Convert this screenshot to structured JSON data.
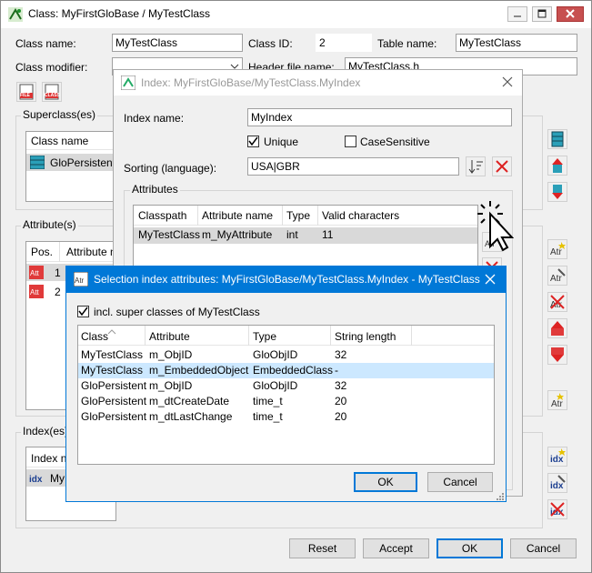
{
  "main": {
    "title": "Class: MyFirstGloBase / MyTestClass",
    "class_name_label": "Class name:",
    "class_name_value": "MyTestClass",
    "class_id_label": "Class ID:",
    "class_id_value": "2",
    "table_name_label": "Table name:",
    "table_name_value": "MyTestClass",
    "class_modifier_label": "Class modifier:",
    "header_file_label": "Header file name:",
    "header_file_value": "MyTestClass.h",
    "file_icon_text": "FILE",
    "class_icon_text": "CLASS",
    "superclass_label": "Superclass(es)",
    "superclass_col": "Class name",
    "superclass_item": "GloPersistent",
    "attribute_label": "Attribute(s)",
    "attr_col_pos": "Pos.",
    "attr_col_name": "Attribute n",
    "attr_rows": [
      {
        "pos": "1"
      },
      {
        "pos": "2"
      }
    ],
    "index_label": "Index(es)",
    "index_col": "Index n",
    "index_item": "My",
    "reset": "Reset",
    "accept": "Accept",
    "ok": "OK",
    "cancel": "Cancel"
  },
  "index_dialog": {
    "title": "Index: MyFirstGloBase/MyTestClass.MyIndex",
    "index_name_label": "Index name:",
    "index_name_value": "MyIndex",
    "unique_label": "Unique",
    "unique_checked": true,
    "case_label": "CaseSensitive",
    "case_checked": false,
    "sorting_label": "Sorting (language):",
    "sorting_value": "USA|GBR",
    "attributes_group": "Attributes",
    "columns": [
      "Classpath",
      "Attribute name",
      "Type",
      "Valid characters"
    ],
    "rows": [
      [
        "MyTestClass",
        "m_MyAttribute",
        "int",
        "11"
      ]
    ]
  },
  "selection_dialog": {
    "title": "Selection index attributes: MyFirstGloBase/MyTestClass.MyIndex - MyTestClass",
    "incl_label": "incl. super classes of MyTestClass",
    "incl_checked": true,
    "columns": [
      "Class",
      "Attribute",
      "Type",
      "String length"
    ],
    "rows": [
      [
        "MyTestClass",
        "m_ObjID",
        "GloObjID",
        "32"
      ],
      [
        "MyTestClass",
        "m_EmbeddedObject",
        "EmbeddedClass",
        "-"
      ],
      [
        "GloPersistent",
        "m_ObjID",
        "GloObjID",
        "32"
      ],
      [
        "GloPersistent",
        "m_dtCreateDate",
        "time_t",
        "20"
      ],
      [
        "GloPersistent",
        "m_dtLastChange",
        "time_t",
        "20"
      ]
    ],
    "selected_row": 1,
    "ok": "OK",
    "cancel": "Cancel"
  },
  "colors": {
    "accent": "#0078d7",
    "selection": "#cce8ff",
    "grey_selection": "#d9d9d9"
  }
}
